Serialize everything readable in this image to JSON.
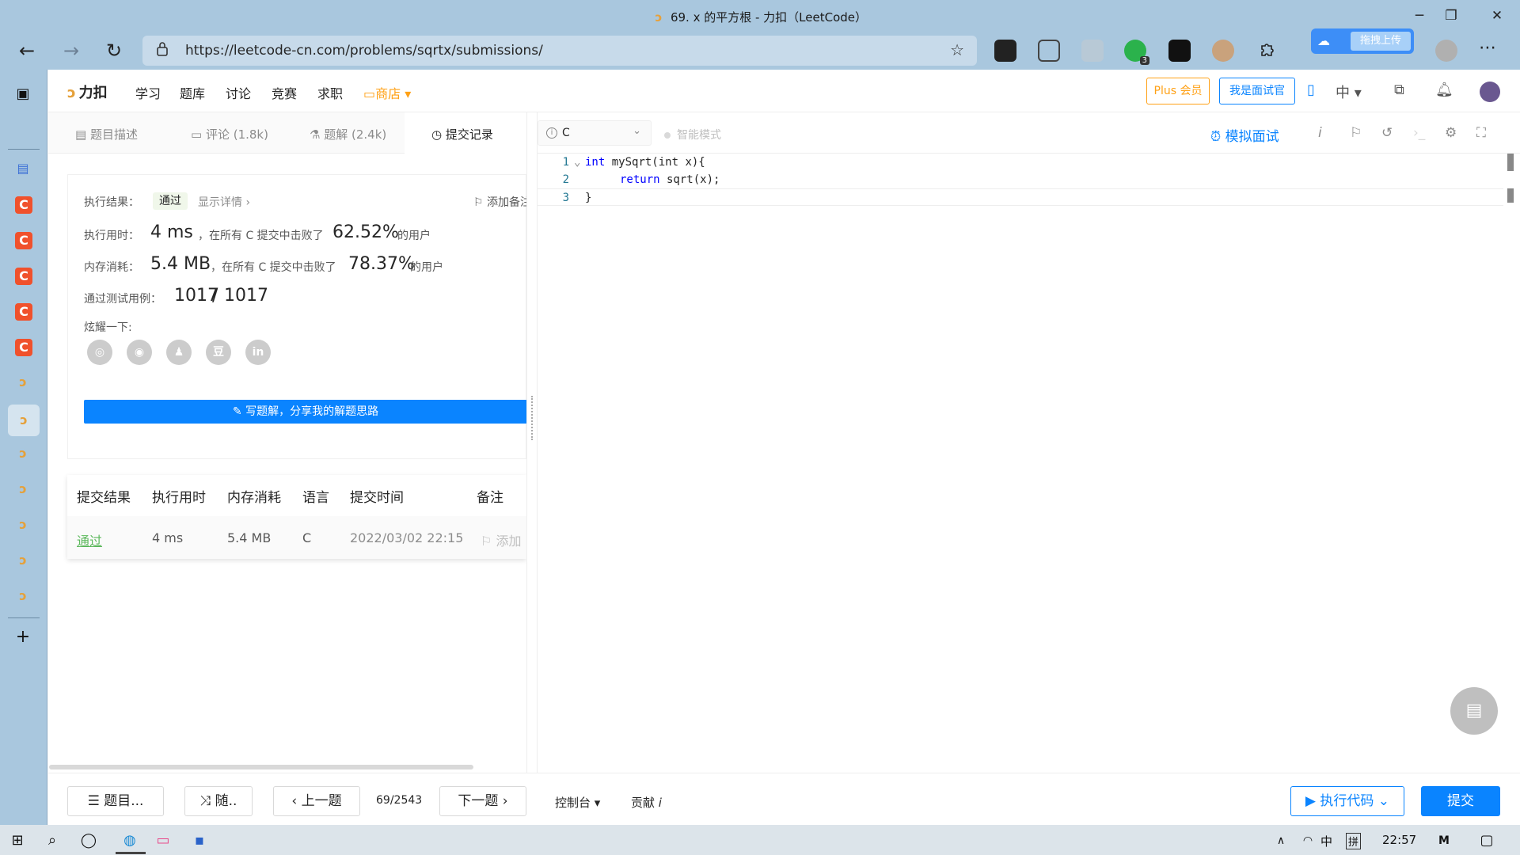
{
  "browser": {
    "window_title": "69. x 的平方根 - 力扣（LeetCode）",
    "url": "https://leetcode-cn.com/problems/sqrtx/submissions/",
    "baidu_upload_label": "拖拽上传",
    "ext_badge": "3"
  },
  "lc_header": {
    "logo": "力扣",
    "nav": [
      "学习",
      "题库",
      "讨论",
      "竞赛",
      "求职"
    ],
    "shop": "商店",
    "plus_button": "Plus 会员",
    "interviewer_button": "我是面试官",
    "lang_toggle": "中"
  },
  "tabs": {
    "description": "题目描述",
    "comments": "评论 (1.8k)",
    "solutions": "题解 (2.4k)",
    "submissions": "提交记录"
  },
  "result": {
    "result_label": "执行结果：",
    "status": "通过",
    "show_details": "显示详情 ›",
    "add_note": "添加备注",
    "runtime_label": "执行用时：",
    "runtime_value": "4 ms",
    "runtime_mid": "，在所有 C 提交中击败了",
    "runtime_pct": "62.52%",
    "users_suffix": "的用户",
    "memory_label": "内存消耗：",
    "memory_value": "5.4 MB",
    "memory_mid": "，在所有 C 提交中击败了",
    "memory_pct": "78.37%",
    "tests_label": "通过测试用例：",
    "tests_passed": "1017",
    "tests_sep": "/",
    "tests_total": "1017",
    "share_label": "炫耀一下:",
    "write_solution": "写题解，分享我的解题思路"
  },
  "submissions_table": {
    "headers": [
      "提交结果",
      "执行用时",
      "内存消耗",
      "语言",
      "提交时间",
      "备注"
    ],
    "rows": [
      {
        "status": "通过",
        "runtime": "4 ms",
        "memory": "5.4 MB",
        "lang": "C",
        "time": "2022/03/02 22:15",
        "note": "添加"
      }
    ]
  },
  "editor": {
    "language": "C",
    "smart_mode": "智能模式",
    "mock_interview": "模拟面试",
    "lines": [
      {
        "n": "1",
        "kw": "int",
        "rest": " mySqrt(int x){"
      },
      {
        "n": "2",
        "kw": "return",
        "rest": " sqrt(x);"
      },
      {
        "n": "3",
        "kw": "",
        "rest": "}"
      }
    ]
  },
  "bottom_bar": {
    "problem_list": "题目...",
    "random": "随..",
    "prev": "上一题",
    "page": "69/2543",
    "next": "下一题",
    "console": "控制台",
    "contribute": "贡献",
    "run": "执行代码",
    "submit": "提交"
  },
  "taskbar": {
    "ime": "中",
    "ime2": "拼",
    "clock": "22:57"
  }
}
